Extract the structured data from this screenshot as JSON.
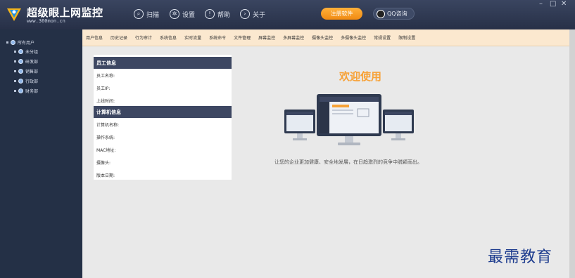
{
  "app": {
    "title": "超级眼上网监控",
    "url": "www.360mon.cn"
  },
  "header_nav": [
    {
      "label": "扫描",
      "icon": "search-icon"
    },
    {
      "label": "设置",
      "icon": "gear-icon"
    },
    {
      "label": "帮助",
      "icon": "help-icon"
    },
    {
      "label": "关于",
      "icon": "info-icon"
    }
  ],
  "header_buttons": {
    "register": "注册软件",
    "qq": "QQ咨询"
  },
  "window_controls": {
    "minimize": "–",
    "maximize": "□",
    "close": "✕"
  },
  "sidebar": {
    "root": "所有用户",
    "groups": [
      "未分组",
      "研发部",
      "销售部",
      "行政部",
      "财务部"
    ]
  },
  "tabs": [
    "用户信息",
    "历史记录",
    "行为审计",
    "系统信息",
    "实时流量",
    "系统命令",
    "文件管理",
    "屏幕监控",
    "多屏幕监控",
    "摄像头监控",
    "多摄像头监控",
    "常规设置",
    "限制设置"
  ],
  "employee_info": {
    "heading": "员工信息",
    "fields": [
      "员工名称:",
      "员工IP:",
      "上线时间:"
    ]
  },
  "computer_info": {
    "heading": "计算机信息",
    "fields": [
      "计算机名称:",
      "操作系统:",
      "MAC地址:",
      "摄像头:",
      "版本日期:"
    ]
  },
  "welcome": {
    "title": "欢迎使用",
    "slogan": "让您的企业更加健康、安全地发展，在日趋激烈的竞争中脱颖而出。"
  },
  "watermark": "最需教育",
  "colors": {
    "accent": "#f7a238",
    "header_bg": "#2d3850",
    "tab_bar": "#fbe8cf",
    "section_head": "#3d4762"
  }
}
